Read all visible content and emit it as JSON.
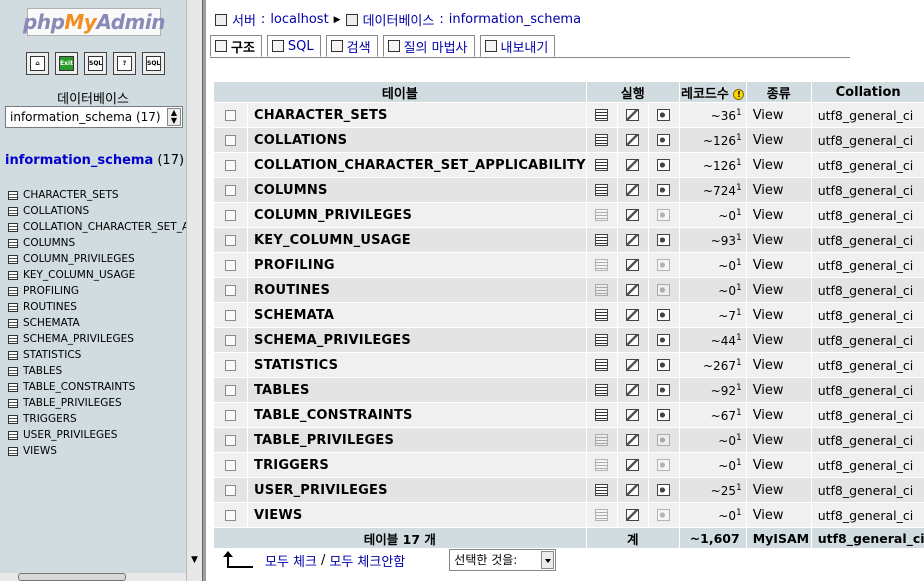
{
  "left": {
    "logo": {
      "part1": "php",
      "part2": "My",
      "part3": "Admin"
    },
    "nav_icons": [
      {
        "icon": "home-icon",
        "glyph": "⌂"
      },
      {
        "icon": "exit-icon",
        "glyph": "Exit"
      },
      {
        "icon": "sql-icon",
        "glyph": "SQL"
      },
      {
        "icon": "help-icon",
        "glyph": "?"
      },
      {
        "icon": "sql-docs-icon",
        "glyph": "SQL"
      }
    ],
    "db_label": "데이터베이스",
    "db_select_value": "information_schema (17)",
    "db_title": "information_schema",
    "db_title_count": "(17)",
    "tables": [
      "CHARACTER_SETS",
      "COLLATIONS",
      "COLLATION_CHARACTER_SET_APPLICABILITY",
      "COLUMNS",
      "COLUMN_PRIVILEGES",
      "KEY_COLUMN_USAGE",
      "PROFILING",
      "ROUTINES",
      "SCHEMATA",
      "SCHEMA_PRIVILEGES",
      "STATISTICS",
      "TABLES",
      "TABLE_CONSTRAINTS",
      "TABLE_PRIVILEGES",
      "TRIGGERS",
      "USER_PRIVILEGES",
      "VIEWS"
    ]
  },
  "breadcrumb": {
    "server_label": "서버",
    "server_value": "localhost",
    "db_label": "데이터베이스",
    "db_value": "information_schema"
  },
  "tabs": [
    {
      "label": "구조",
      "active": true,
      "icon": "structure-icon"
    },
    {
      "label": "SQL",
      "active": false,
      "icon": "sql-icon"
    },
    {
      "label": "검색",
      "active": false,
      "icon": "search-icon"
    },
    {
      "label": "질의 마법사",
      "active": false,
      "icon": "query-icon"
    },
    {
      "label": "내보내기",
      "active": false,
      "icon": "export-icon"
    }
  ],
  "table": {
    "headers": {
      "table": "테이블",
      "action": "실행",
      "records": "레코드수",
      "type": "종류",
      "collation": "Collation"
    },
    "rows": [
      {
        "name": "CHARACTER_SETS",
        "records": "~36",
        "sup": "1",
        "type": "View",
        "collation": "utf8_general_ci",
        "dim": false
      },
      {
        "name": "COLLATIONS",
        "records": "~126",
        "sup": "1",
        "type": "View",
        "collation": "utf8_general_ci",
        "dim": false
      },
      {
        "name": "COLLATION_CHARACTER_SET_APPLICABILITY",
        "records": "~126",
        "sup": "1",
        "type": "View",
        "collation": "utf8_general_ci",
        "dim": false
      },
      {
        "name": "COLUMNS",
        "records": "~724",
        "sup": "1",
        "type": "View",
        "collation": "utf8_general_ci",
        "dim": false
      },
      {
        "name": "COLUMN_PRIVILEGES",
        "records": "~0",
        "sup": "1",
        "type": "View",
        "collation": "utf8_general_ci",
        "dim": true
      },
      {
        "name": "KEY_COLUMN_USAGE",
        "records": "~93",
        "sup": "1",
        "type": "View",
        "collation": "utf8_general_ci",
        "dim": false
      },
      {
        "name": "PROFILING",
        "records": "~0",
        "sup": "1",
        "type": "View",
        "collation": "utf8_general_ci",
        "dim": true
      },
      {
        "name": "ROUTINES",
        "records": "~0",
        "sup": "1",
        "type": "View",
        "collation": "utf8_general_ci",
        "dim": true
      },
      {
        "name": "SCHEMATA",
        "records": "~7",
        "sup": "1",
        "type": "View",
        "collation": "utf8_general_ci",
        "dim": false
      },
      {
        "name": "SCHEMA_PRIVILEGES",
        "records": "~44",
        "sup": "1",
        "type": "View",
        "collation": "utf8_general_ci",
        "dim": false
      },
      {
        "name": "STATISTICS",
        "records": "~267",
        "sup": "1",
        "type": "View",
        "collation": "utf8_general_ci",
        "dim": false
      },
      {
        "name": "TABLES",
        "records": "~92",
        "sup": "1",
        "type": "View",
        "collation": "utf8_general_ci",
        "dim": false
      },
      {
        "name": "TABLE_CONSTRAINTS",
        "records": "~67",
        "sup": "1",
        "type": "View",
        "collation": "utf8_general_ci",
        "dim": false
      },
      {
        "name": "TABLE_PRIVILEGES",
        "records": "~0",
        "sup": "1",
        "type": "View",
        "collation": "utf8_general_ci",
        "dim": true
      },
      {
        "name": "TRIGGERS",
        "records": "~0",
        "sup": "1",
        "type": "View",
        "collation": "utf8_general_ci",
        "dim": true
      },
      {
        "name": "USER_PRIVILEGES",
        "records": "~25",
        "sup": "1",
        "type": "View",
        "collation": "utf8_general_ci",
        "dim": false
      },
      {
        "name": "VIEWS",
        "records": "~0",
        "sup": "1",
        "type": "View",
        "collation": "utf8_general_ci",
        "dim": true
      }
    ],
    "footer": {
      "count": "테이블 17 개",
      "sum_label": "계",
      "records": "~1,607",
      "type": "MyISAM",
      "collation": "utf8_general_ci"
    }
  },
  "bottom": {
    "check_all": "모두 체크",
    "slash": "/",
    "uncheck_all": "모두 체크안함",
    "with_selected": "선택한 것을:"
  }
}
